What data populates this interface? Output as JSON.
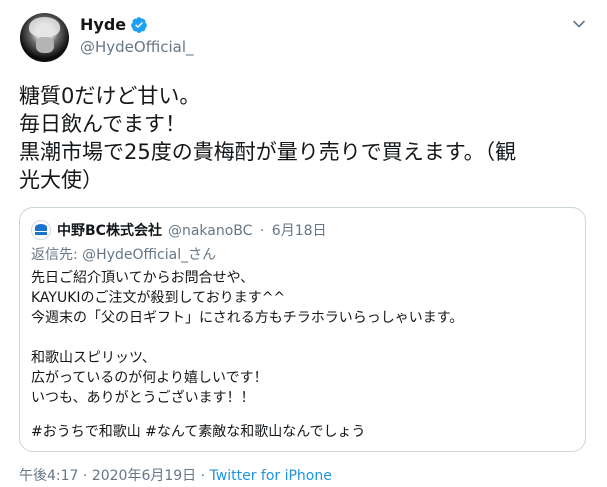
{
  "author": {
    "display_name": "Hyde",
    "handle": "@HydeOfficial_",
    "verified_icon": "verified-badge-icon",
    "more_icon": "chevron-down-icon"
  },
  "tweet": {
    "lines": [
      "糖質0だけど甘い。",
      "毎日飲んでます！",
      "黒潮市場で25度の貴梅酎が量り売りで買えます。（観",
      "光大使）"
    ]
  },
  "quote": {
    "name": "中野BC株式会社",
    "handle": "@nakanoBC",
    "separator": "·",
    "date": "6月18日",
    "reply_label": "返信先:",
    "reply_to": "@HydeOfficial_さん",
    "body": [
      "先日ご紹介頂いてからお問合せや、",
      "KAYUKIのご注文が殺到しております^^",
      "今週末の「父の日ギフト」にされる方もチラホラいらっしゃいます。",
      "",
      "和歌山スピリッツ、",
      "広がっているのが何より嬉しいです！",
      "いつも、ありがとうございます！！",
      ""
    ],
    "hashtags": "#おうちで和歌山 #なんて素敵な和歌山なんでしょう"
  },
  "footer": {
    "time": "午後4:17",
    "separator1": "·",
    "date": "2020年6月19日",
    "separator2": "·",
    "source": "Twitter for iPhone"
  },
  "colors": {
    "verified": "#1da1f2",
    "secondary_text": "#657786",
    "link": "#1b95e0",
    "border": "#ccd6dd"
  }
}
